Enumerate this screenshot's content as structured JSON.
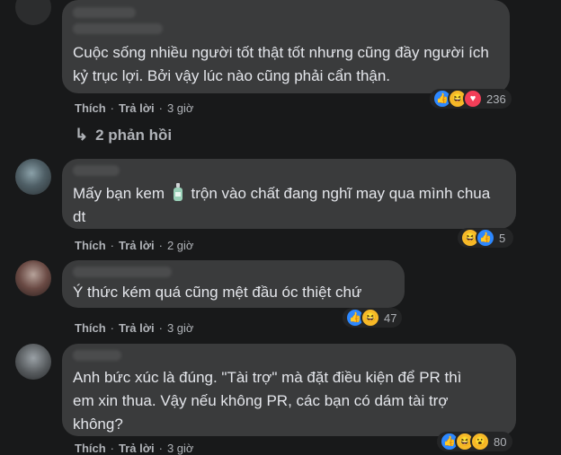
{
  "comments": [
    {
      "text": "Cuộc sống nhiều người tốt thật tốt nhưng cũng đầy người ích kỷ trục lợi. Bởi vậy lúc nào cũng phải cẩn thận.",
      "like_label": "Thích",
      "reply_label": "Trả lời",
      "time": "3 giờ",
      "reactions": [
        "like-icon",
        "haha-icon",
        "love-icon"
      ],
      "reaction_count": "236",
      "replies_label": "2 phản hồi"
    },
    {
      "text_before_icon": "Mấy bạn kem",
      "text_icon": "lotion-bottle-icon",
      "text_after_icon": "trộn vào chất đang nghĩ may qua mình chua dt",
      "like_label": "Thích",
      "reply_label": "Trả lời",
      "time": "2 giờ",
      "reactions": [
        "haha-icon",
        "like-icon"
      ],
      "reaction_count": "5"
    },
    {
      "text": "Ý thức kém quá cũng mệt đầu óc thiệt chứ",
      "like_label": "Thích",
      "reply_label": "Trả lời",
      "time": "3 giờ",
      "reactions": [
        "like-icon",
        "haha-icon"
      ],
      "reaction_count": "47"
    },
    {
      "text": "Anh bức xúc là đúng. \"Tài trợ\" mà đặt điều kiện để PR thì em xin thua. Vậy nếu không PR, các bạn có dám tài trợ không?",
      "like_label": "Thích",
      "reply_label": "Trả lời",
      "time": "3 giờ",
      "reactions": [
        "like-icon",
        "haha-icon",
        "wow-icon"
      ],
      "reaction_count": "80"
    }
  ],
  "colors": {
    "background": "#18191a",
    "bubble": "#3a3b3c",
    "text": "#e4e6eb",
    "secondary": "#b0b3b8",
    "like": "#2d88ff",
    "haha": "#f7b928",
    "love": "#f33e58"
  }
}
